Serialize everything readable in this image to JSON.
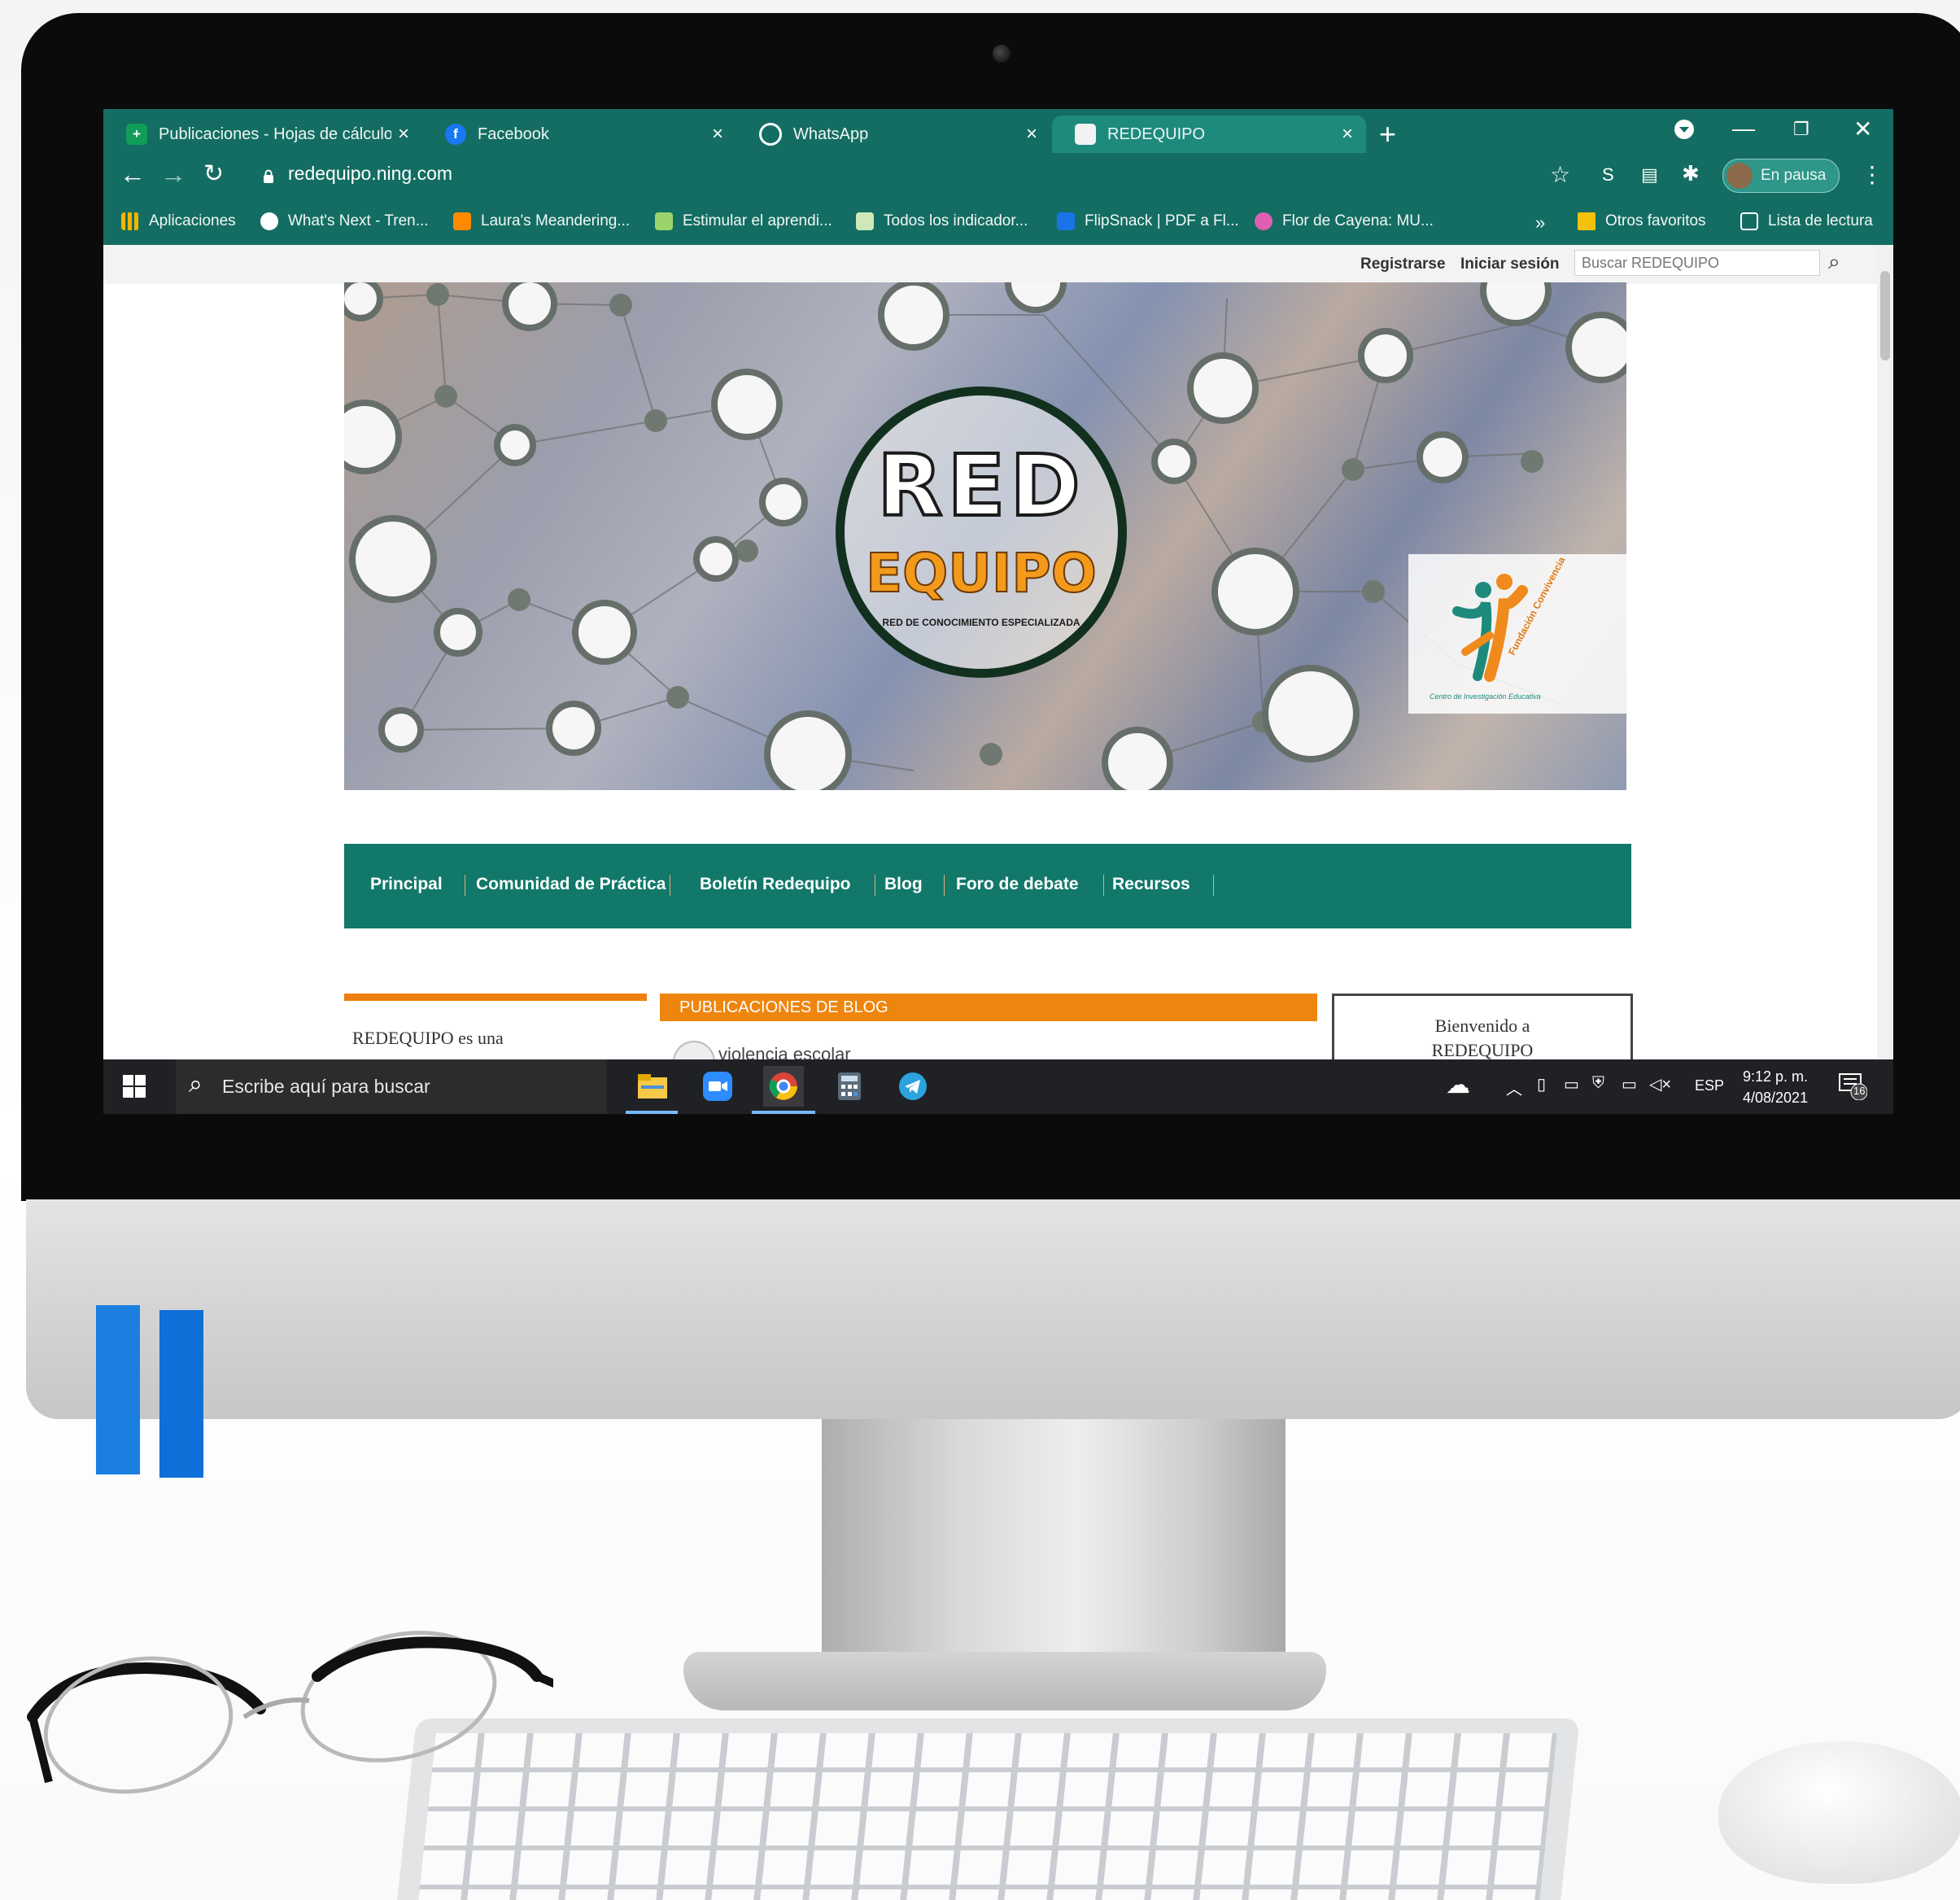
{
  "browser": {
    "tabs": [
      {
        "label": "Publicaciones - Hojas de cálculo",
        "icon": "google-sheets-icon",
        "icon_color": "#0f9d58",
        "active": false
      },
      {
        "label": "Facebook",
        "icon": "facebook-icon",
        "icon_color": "#1877f2",
        "active": false
      },
      {
        "label": "WhatsApp",
        "icon": "whatsapp-icon",
        "icon_color": "#ffffff",
        "active": false
      },
      {
        "label": "REDEQUIPO",
        "icon": "redequipo-favicon",
        "icon_color": "#f2f2f2",
        "active": true
      }
    ],
    "close_glyph": "×",
    "new_tab_glyph": "+",
    "url": "redequipo.ning.com",
    "profile_label": "En pausa",
    "theme_color": "#146d62",
    "bookmarks": [
      {
        "label": "Aplicaciones",
        "icon": "apps-grid-icon",
        "color": "#f4b400"
      },
      {
        "label": "What's Next - Tren...",
        "icon": "globe-icon",
        "color": "#ffffff"
      },
      {
        "label": "Laura's Meandering...",
        "icon": "blogger-icon",
        "color": "#ff8a00"
      },
      {
        "label": "Estimular el aprendi...",
        "icon": "site-icon",
        "color": "#9bd36b"
      },
      {
        "label": "Todos los indicador...",
        "icon": "site-icon",
        "color": "#cfe8b8"
      },
      {
        "label": "FlipSnack | PDF a Fl...",
        "icon": "flipsnack-icon",
        "color": "#1a73e8"
      },
      {
        "label": "Flor de Cayena: MU...",
        "icon": "flower-icon",
        "color": "#e05fb0"
      }
    ],
    "bookmarks_overflow": "»",
    "other_bookmarks": "Otros favoritos",
    "reading_list": "Lista de lectura"
  },
  "site": {
    "register": "Registrarse",
    "login": "Iniciar sesión",
    "search_placeholder": "Buscar REDEQUIPO",
    "banner": {
      "logo_red": "RED",
      "logo_equipo": "EQUIPO",
      "logo_subtitle": "RED DE CONOCIMIENTO ESPECIALIZADA",
      "partner_name": "Fundación Convivencia",
      "partner_sub": "Centro de Investigación Educativa"
    },
    "nav": [
      "Principal",
      "Comunidad de Práctica",
      "Boletín Redequipo",
      "Blog",
      "Foro de debate",
      "Recursos"
    ],
    "accent_green": "#11786a",
    "accent_orange": "#ee850e",
    "left_text": "REDEQUIPO es una",
    "blog_header": "PUBLICACIONES DE BLOG",
    "blog_first_item": "violencia escolar",
    "welcome_line1": "Bienvenido a",
    "welcome_line2": "REDEQUIPO"
  },
  "taskbar": {
    "search_placeholder": "Escribe aquí para buscar",
    "apps": [
      "file-explorer-icon",
      "zoom-icon",
      "chrome-icon",
      "calculator-icon",
      "telegram-icon"
    ],
    "language": "ESP",
    "time": "9:12 p. m.",
    "date": "4/08/2021",
    "notifications": "16"
  }
}
